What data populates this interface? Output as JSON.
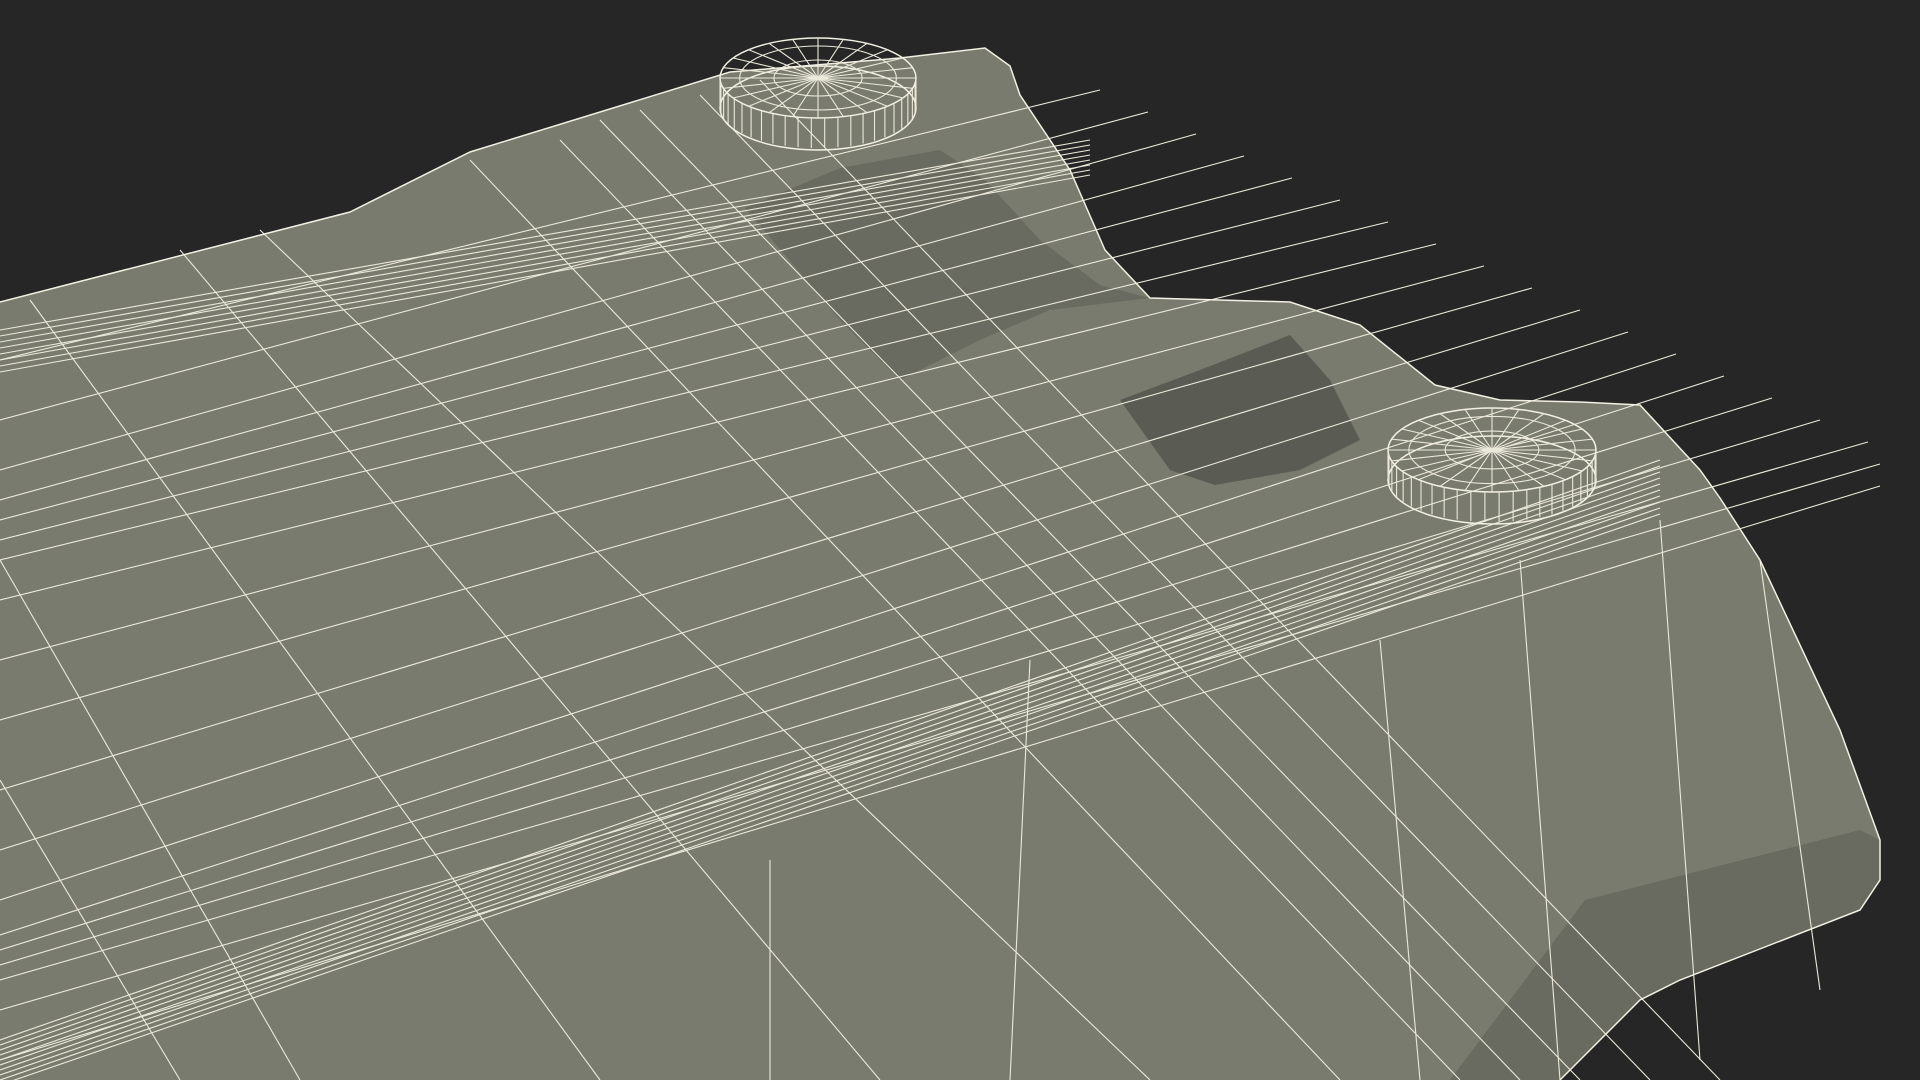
{
  "scene": {
    "background_color": "#262626",
    "mesh_color": "#7a7b6f",
    "wire_color": "#f2f0e2",
    "objects": [
      "wireframe-plate",
      "round-foot-left",
      "round-foot-right"
    ]
  }
}
